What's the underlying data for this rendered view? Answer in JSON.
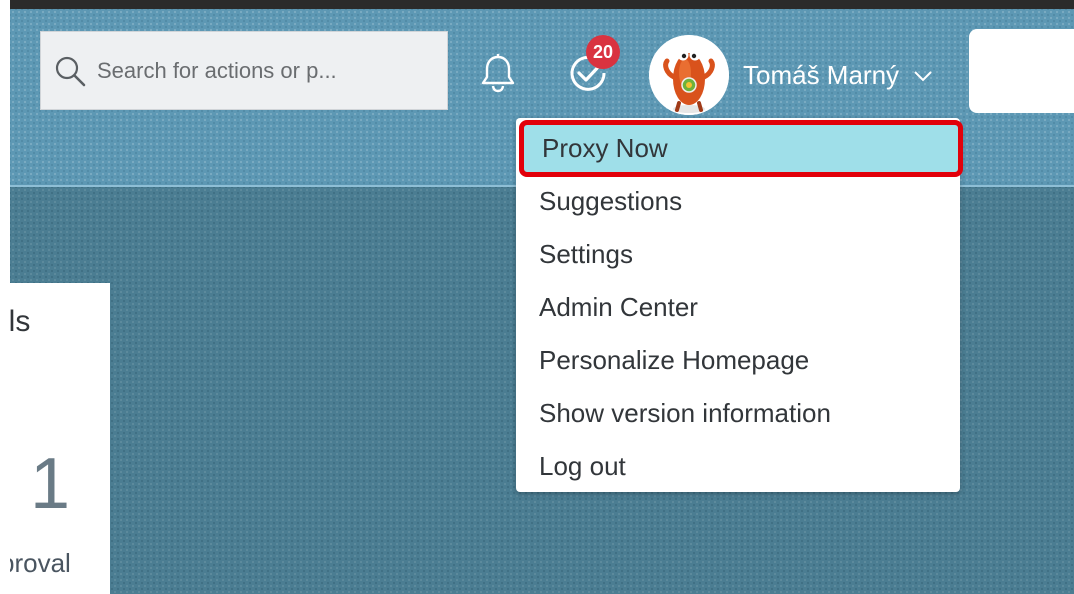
{
  "search": {
    "placeholder": "Search for actions or p..."
  },
  "notifications": {
    "bell_icon": "bell-icon",
    "task_icon": "task-check-icon",
    "task_badge": "20",
    "badge_color": "#d93340"
  },
  "user": {
    "name": "Tomáš Marný",
    "avatar_icon": "mascot-avatar",
    "chevron_icon": "chevron-down-icon"
  },
  "menu": {
    "items": [
      {
        "label": "Proxy Now",
        "highlighted": true
      },
      {
        "label": "Suggestions"
      },
      {
        "label": "Settings"
      },
      {
        "label": "Admin Center"
      },
      {
        "label": "Personalize Homepage"
      },
      {
        "label": "Show version information"
      },
      {
        "label": "Log out"
      }
    ],
    "highlight_color": "#9fdfe9",
    "highlight_border_color": "#e2000a"
  },
  "tile": {
    "title": "als",
    "count": "1",
    "subtitle": "proval"
  },
  "colors": {
    "header": "#5d98b4",
    "content": "#4b7d92"
  }
}
